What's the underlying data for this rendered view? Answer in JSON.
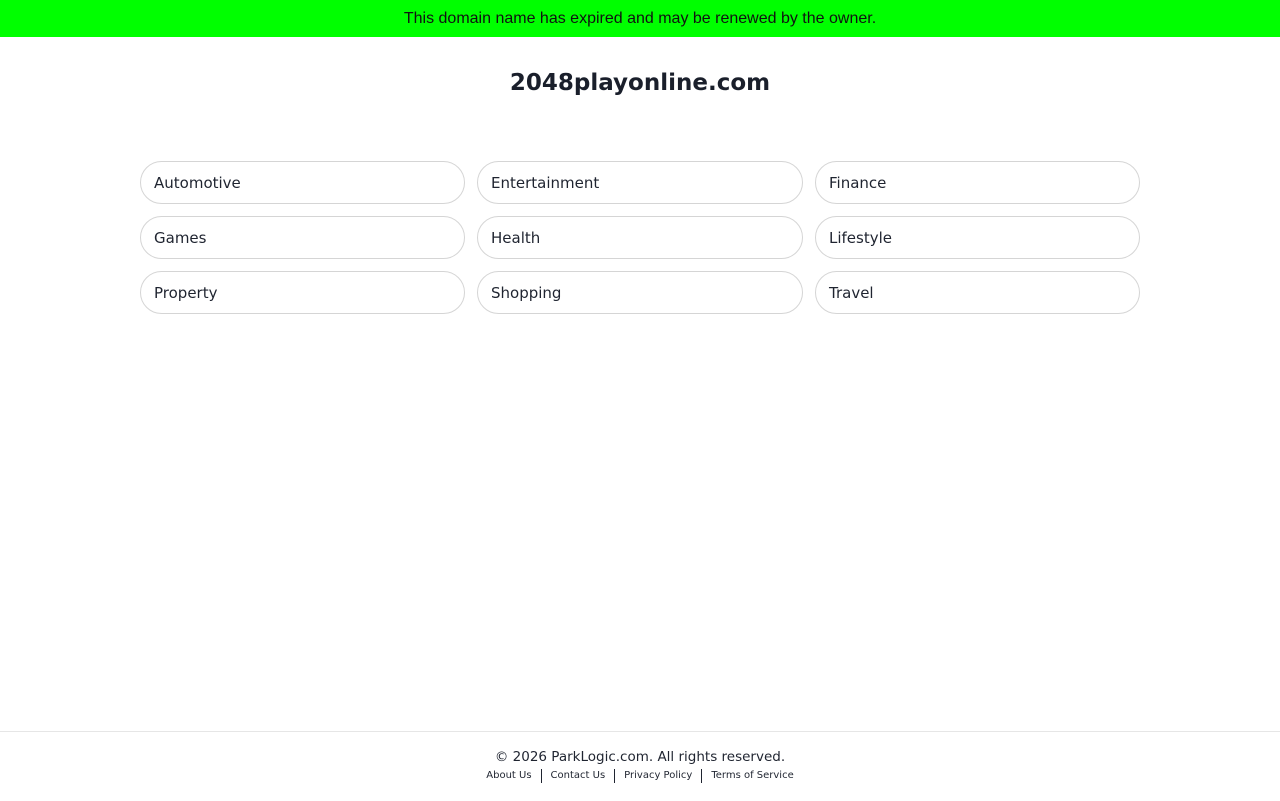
{
  "banner": {
    "text": "This domain name has expired and may be renewed by the owner.",
    "color": "#00ff00"
  },
  "site": {
    "title": "2048playonline.com"
  },
  "categories": [
    "Automotive",
    "Entertainment",
    "Finance",
    "Games",
    "Health",
    "Lifestyle",
    "Property",
    "Shopping",
    "Travel"
  ],
  "footer": {
    "copyright": "© 2026 ParkLogic.com. All rights reserved.",
    "links": [
      "About Us",
      "Contact Us",
      "Privacy Policy",
      "Terms of Service"
    ]
  }
}
